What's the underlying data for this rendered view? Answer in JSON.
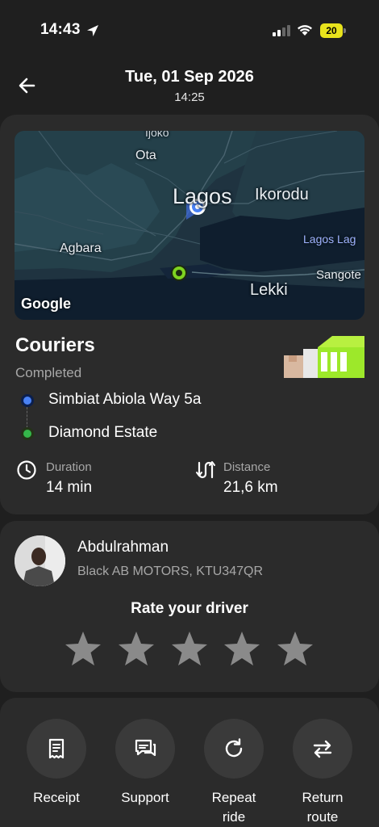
{
  "status_bar": {
    "time": "14:43",
    "battery": "20",
    "icons": [
      "location-arrow-icon",
      "signal-icon",
      "wifi-icon",
      "battery-icon"
    ],
    "battery_color": "#e8e31c"
  },
  "header": {
    "date": "Tue, 01 Sep 2026",
    "time": "14:25",
    "back_icon": "back-arrow-icon"
  },
  "map": {
    "labels": {
      "ijoko": "Ijoko",
      "ota": "Ota",
      "lagos": "Lagos",
      "ikorodu": "Ikorodu",
      "lagos_lagoon": "Lagos Lag",
      "agbara": "Agbara",
      "sangote": "Sangote",
      "lekki": "Lekki"
    },
    "attribution": "Google",
    "pickup_color": "#4a82f5",
    "dropoff_color": "#7ed321"
  },
  "trip": {
    "title": "Couriers",
    "status": "Completed",
    "pickup": "Simbiat Abiola Way 5a",
    "dropoff": "Diamond Estate",
    "duration_label": "Duration",
    "duration_value": "14 min",
    "distance_label": "Distance",
    "distance_value": "21,6 km"
  },
  "driver": {
    "name": "Abdulrahman",
    "car": "Black  AB MOTORS, KTU347QR",
    "rate_title": "Rate your driver",
    "rating": 0,
    "max_rating": 5
  },
  "actions": [
    {
      "label": "Receipt",
      "icon": "receipt-icon"
    },
    {
      "label": "Support",
      "icon": "chat-icon"
    },
    {
      "label": "Repeat ride",
      "icon": "refresh-icon"
    },
    {
      "label": "Return route",
      "icon": "swap-arrows-icon"
    }
  ]
}
